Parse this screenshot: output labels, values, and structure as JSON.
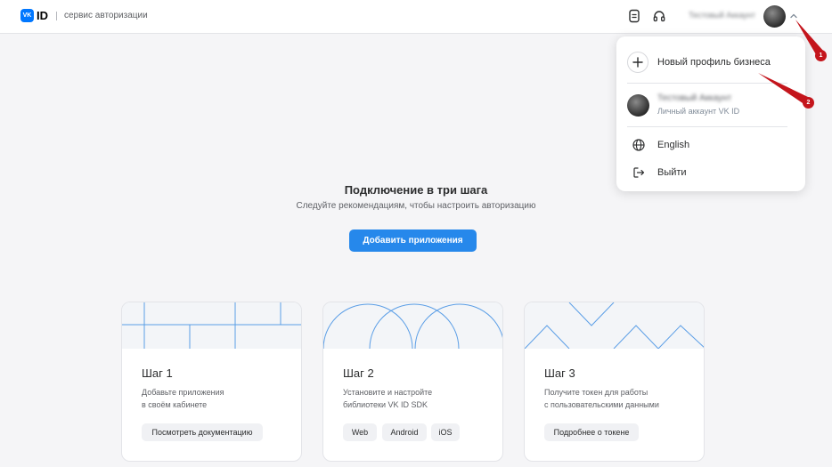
{
  "header": {
    "logo_badge": "VK",
    "logo_id": "ID",
    "logo_subtitle": "сервис авторизации",
    "user_name": "Тестовый Аккаунт",
    "icons": [
      "document-icon",
      "headset-icon",
      "chevron-up-icon"
    ]
  },
  "dropdown": {
    "new_business": "Новый профиль бизнеса",
    "account_name": "Тестовый Аккаунт",
    "account_type": "Личный аккаунт VK ID",
    "language": "English",
    "logout": "Выйти"
  },
  "main": {
    "title": "Подключение в три шага",
    "subtitle": "Следуйте рекомендациям, чтобы настроить авторизацию",
    "add_button": "Добавить приложения"
  },
  "steps": [
    {
      "title": "Шаг 1",
      "desc1": "Добавьте приложения",
      "desc2": "в своём кабинете",
      "chips": [
        "Посмотреть документацию"
      ]
    },
    {
      "title": "Шаг 2",
      "desc1": "Установите и настройте",
      "desc2": "библиотеки VK ID SDK",
      "chips": [
        "Web",
        "Android",
        "iOS"
      ]
    },
    {
      "title": "Шаг 3",
      "desc1": "Получите токен для работы",
      "desc2": "с пользовательскими данными",
      "chips": [
        "Подробнее о токене"
      ]
    }
  ],
  "annotations": [
    "1",
    "2"
  ],
  "colors": {
    "accent": "#2688eb",
    "brand": "#0077ff",
    "annotation": "#c4151c"
  }
}
